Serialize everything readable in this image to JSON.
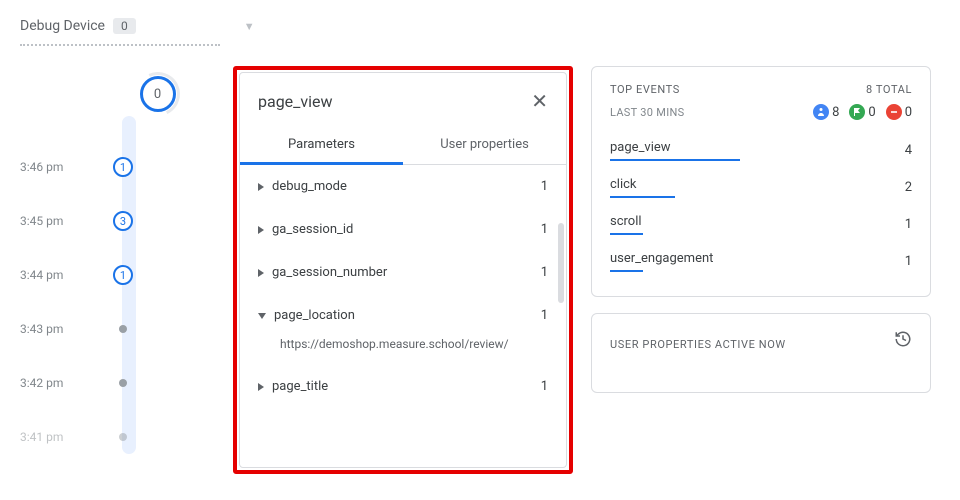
{
  "header": {
    "title": "Debug Device",
    "count": "0"
  },
  "timeline": {
    "current_count": "0",
    "rows": [
      {
        "time": "3:46 pm",
        "type": "count",
        "value": "1"
      },
      {
        "time": "3:45 pm",
        "type": "count",
        "value": "3"
      },
      {
        "time": "3:44 pm",
        "type": "count",
        "value": "1"
      },
      {
        "time": "3:43 pm",
        "type": "dot",
        "value": ""
      },
      {
        "time": "3:42 pm",
        "type": "dot",
        "value": ""
      },
      {
        "time": "3:41 pm",
        "type": "dot",
        "value": "",
        "faded": true
      }
    ]
  },
  "event_panel": {
    "title": "page_view",
    "tabs": {
      "parameters": "Parameters",
      "user_properties": "User properties"
    },
    "params": [
      {
        "name": "debug_mode",
        "count": "1",
        "expanded": false
      },
      {
        "name": "ga_session_id",
        "count": "1",
        "expanded": false
      },
      {
        "name": "ga_session_number",
        "count": "1",
        "expanded": false
      },
      {
        "name": "page_location",
        "count": "1",
        "expanded": true,
        "value": "https://demoshop.measure.school/review/"
      },
      {
        "name": "page_title",
        "count": "1",
        "expanded": false
      }
    ]
  },
  "top_events": {
    "title": "TOP EVENTS",
    "total_label": "8 TOTAL",
    "subtitle": "LAST 30 MINS",
    "stats": {
      "users": "8",
      "conversions": "0",
      "errors": "0"
    },
    "items": [
      {
        "name": "page_view",
        "count": "4",
        "bar": 100
      },
      {
        "name": "click",
        "count": "2",
        "bar": 50
      },
      {
        "name": "scroll",
        "count": "1",
        "bar": 25
      },
      {
        "name": "user_engagement",
        "count": "1",
        "bar": 25
      }
    ]
  },
  "user_props": {
    "title": "USER PROPERTIES ACTIVE NOW"
  }
}
